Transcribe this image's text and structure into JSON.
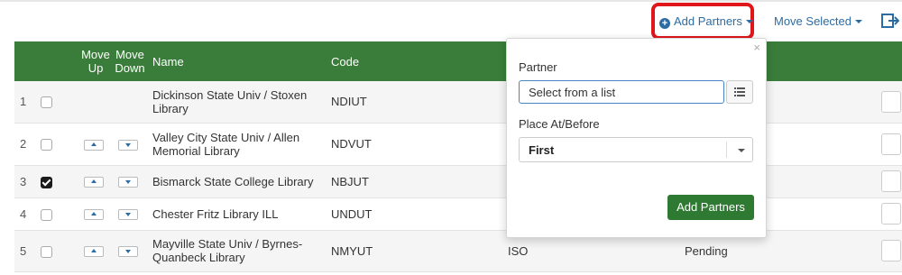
{
  "toolbar": {
    "add_partners_label": "Add Partners",
    "move_selected_label": "Move Selected"
  },
  "table": {
    "headers": {
      "move_up": "Move Up",
      "move_down": "Move Down",
      "name": "Name",
      "code": "Code"
    },
    "rows": [
      {
        "num": "1",
        "checked": false,
        "name": "Dickinson State Univ / Stoxen Library",
        "code": "NDIUT",
        "col5": "",
        "col6": ""
      },
      {
        "num": "2",
        "checked": false,
        "name": "Valley City State Univ / Allen Memorial Library",
        "code": "NDVUT",
        "col5": "",
        "col6": ""
      },
      {
        "num": "3",
        "checked": true,
        "name": "Bismarck State College Library",
        "code": "NBJUT",
        "col5": "",
        "col6": ""
      },
      {
        "num": "4",
        "checked": false,
        "name": "Chester Fritz Library ILL",
        "code": "UNDUT",
        "col5": "",
        "col6": ""
      },
      {
        "num": "5",
        "checked": false,
        "name": "Mayville State Univ / Byrnes-Quanbeck Library",
        "code": "NMYUT",
        "col5": "ISO",
        "col6": "Pending"
      }
    ]
  },
  "popover": {
    "close_glyph": "×",
    "partner_label": "Partner",
    "partner_placeholder": "Select from a list",
    "place_label": "Place At/Before",
    "place_value": "First",
    "submit_label": "Add Partners"
  },
  "colors": {
    "header_green": "#3a7d3a",
    "link_blue": "#2d6ca2",
    "highlight_red": "#e0161b"
  }
}
